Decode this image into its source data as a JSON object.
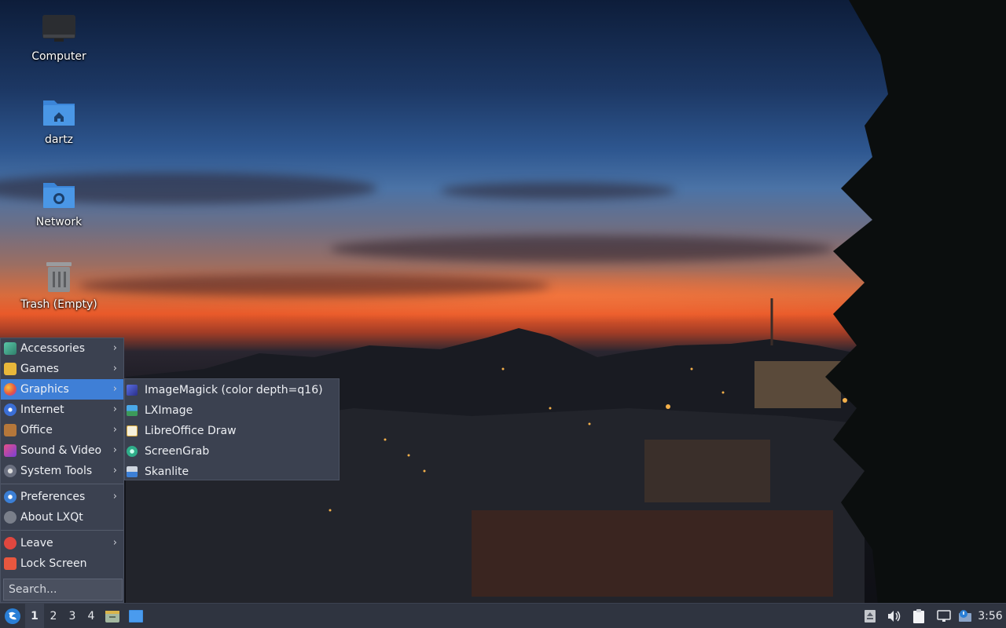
{
  "desktop": {
    "icons": [
      {
        "label": "Computer",
        "icon": "computer-icon"
      },
      {
        "label": "dartz",
        "icon": "home-folder-icon"
      },
      {
        "label": "Network",
        "icon": "network-folder-icon"
      },
      {
        "label": "Trash (Empty)",
        "icon": "trash-icon"
      }
    ]
  },
  "menu": {
    "categories": [
      {
        "label": "Accessories",
        "icon": "accessories-icon",
        "has_submenu": true
      },
      {
        "label": "Games",
        "icon": "games-icon",
        "has_submenu": true
      },
      {
        "label": "Graphics",
        "icon": "graphics-icon",
        "has_submenu": true,
        "active": true
      },
      {
        "label": "Internet",
        "icon": "internet-icon",
        "has_submenu": true
      },
      {
        "label": "Office",
        "icon": "office-icon",
        "has_submenu": true
      },
      {
        "label": "Sound & Video",
        "icon": "sound-video-icon",
        "has_submenu": true
      },
      {
        "label": "System Tools",
        "icon": "system-tools-icon",
        "has_submenu": true
      }
    ],
    "settings": [
      {
        "label": "Preferences",
        "icon": "preferences-icon",
        "has_submenu": true
      },
      {
        "label": "About LXQt",
        "icon": "info-icon",
        "has_submenu": false
      }
    ],
    "session": [
      {
        "label": "Leave",
        "icon": "power-icon",
        "has_submenu": true
      },
      {
        "label": "Lock Screen",
        "icon": "lock-icon",
        "has_submenu": false
      }
    ],
    "search_placeholder": "Search...",
    "active_color": "#3f7fd6"
  },
  "graphics_submenu": {
    "items": [
      {
        "label": "ImageMagick (color depth=q16)",
        "icon": "imagemagick-icon"
      },
      {
        "label": "LXImage",
        "icon": "lximage-icon"
      },
      {
        "label": "LibreOffice Draw",
        "icon": "libreoffice-draw-icon"
      },
      {
        "label": "ScreenGrab",
        "icon": "screengrab-icon"
      },
      {
        "label": "Skanlite",
        "icon": "skanlite-icon"
      }
    ]
  },
  "taskbar": {
    "start_icon": "lxqt-logo-icon",
    "workspaces": [
      "1",
      "2",
      "3",
      "4"
    ],
    "active_workspace": "1",
    "quicklaunch": [
      "file-manager-icon",
      "desktop-icon"
    ],
    "tray": [
      "removable-media-icon",
      "volume-icon",
      "clipboard-icon",
      "monitor-icon",
      "notification-icon"
    ],
    "clock": "3:56"
  }
}
